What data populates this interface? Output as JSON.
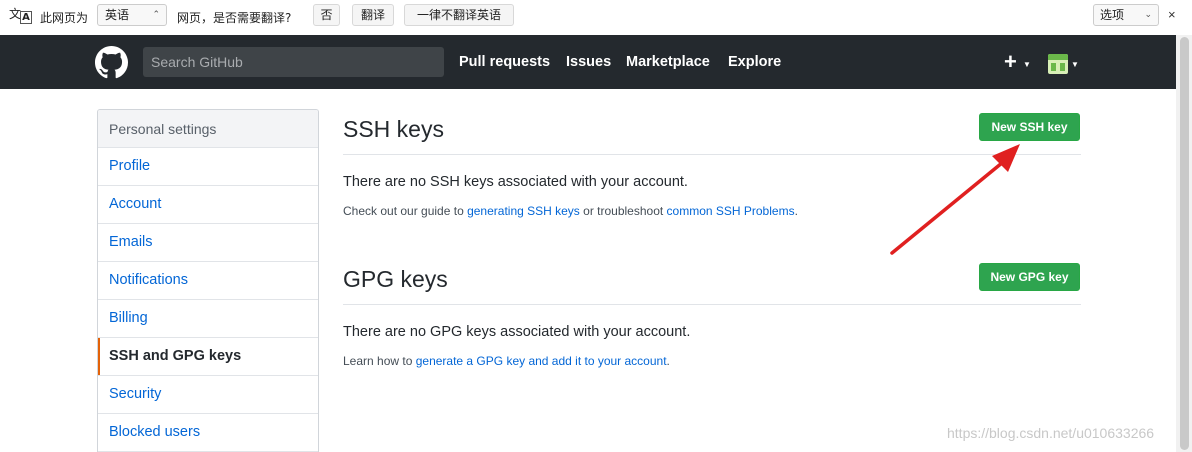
{
  "translate_bar": {
    "page_is": "此网页为",
    "language": "英语",
    "question": "网页，是否需要翻译?",
    "no_label": "否",
    "translate_label": "翻译",
    "never_label": "一律不翻译英语",
    "options_label": "选项",
    "close_label": "×"
  },
  "header": {
    "search_placeholder": "Search GitHub",
    "nav": [
      "Pull requests",
      "Issues",
      "Marketplace",
      "Explore"
    ],
    "plus_label": "+"
  },
  "sidebar": {
    "heading": "Personal settings",
    "items": [
      {
        "label": "Profile"
      },
      {
        "label": "Account"
      },
      {
        "label": "Emails"
      },
      {
        "label": "Notifications"
      },
      {
        "label": "Billing"
      },
      {
        "label": "SSH and GPG keys",
        "active": true
      },
      {
        "label": "Security"
      },
      {
        "label": "Blocked users"
      }
    ]
  },
  "ssh": {
    "title": "SSH keys",
    "button": "New SSH key",
    "empty": "There are no SSH keys associated with your account.",
    "note_pre": "Check out our guide to ",
    "note_link1": "generating SSH keys",
    "note_mid": " or troubleshoot ",
    "note_link2": "common SSH Problems",
    "note_post": "."
  },
  "gpg": {
    "title": "GPG keys",
    "button": "New GPG key",
    "empty": "There are no GPG keys associated with your account.",
    "note_pre": "Learn how to ",
    "note_link": "generate a GPG key and add it to your account",
    "note_post": "."
  },
  "watermark": "https://blog.csdn.net/u010633266",
  "colors": {
    "accent": "#2ea44f",
    "header": "#24292e",
    "link": "#0366d6",
    "annotation": "#e02020"
  }
}
